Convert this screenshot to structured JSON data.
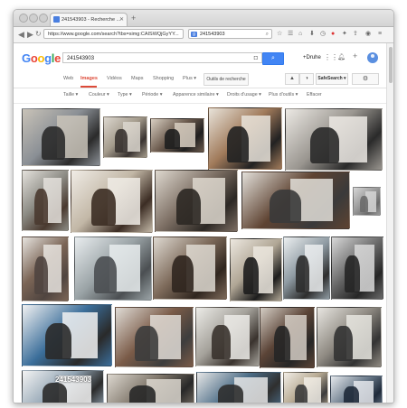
{
  "browser": {
    "tab_title": "241543903 - Recherche ...",
    "url": "https://www.google.com/search?tbs=simg:CAISWQjGyYY...",
    "search_box_value": "241543903"
  },
  "google": {
    "logo": "Google",
    "query": "241543903",
    "user": "+Druhe",
    "nav_tabs": [
      "Web",
      "Images",
      "Vidéos",
      "Maps",
      "Shopping",
      "Plus ▾"
    ],
    "search_by_size": "Outils de recherche",
    "safesearch": "SafeSearch ▾",
    "tools": [
      "Taille ▾",
      "Couleur ▾",
      "Type ▾",
      "Période ▾",
      "Apparence similaire ▾",
      "Droits d'usage ▾",
      "Plus d'outils ▾",
      "Effacer"
    ]
  },
  "results": {
    "watermark": "241543903",
    "images": [
      {
        "colors": [
          "#8a8f95",
          "#2b2b2b",
          "#c9c3b8"
        ]
      },
      {
        "colors": [
          "#a39a8b",
          "#3a3431",
          "#dcd7cf"
        ]
      },
      {
        "colors": [
          "#6b5a4d",
          "#1f1f1f",
          "#d8cfc2"
        ]
      },
      {
        "colors": [
          "#a07a5a",
          "#222222",
          "#e8e3da"
        ]
      },
      {
        "colors": [
          "#9a9690",
          "#2a2a2a",
          "#ece9e4"
        ]
      },
      {
        "colors": [
          "#8c8b84",
          "#4a3a30",
          "#e4e1dc"
        ]
      },
      {
        "colors": [
          "#c2b7a6",
          "#3c2d24",
          "#f0ece6"
        ]
      },
      {
        "colors": [
          "#7c6e63",
          "#2c2824",
          "#ded8cf"
        ]
      },
      {
        "colors": [
          "#5e4332",
          "#3a3a3a",
          "#e2dfd9"
        ]
      },
      {
        "colors": [
          "#9b9b9b",
          "#6b6b6b",
          "#d6d6d6"
        ]
      },
      {
        "colors": [
          "#7b6556",
          "#504540",
          "#e7e4df"
        ]
      },
      {
        "colors": [
          "#9aa3a6",
          "#4b4f52",
          "#e9edef"
        ]
      },
      {
        "colors": [
          "#7d6a5a",
          "#30261f",
          "#ded9d1"
        ]
      },
      {
        "colors": [
          "#b0a695",
          "#1d1d1d",
          "#ece7df"
        ]
      },
      {
        "colors": [
          "#8e9aa2",
          "#2e2e2e",
          "#eceff0"
        ]
      },
      {
        "colors": [
          "#6a6a6a",
          "#262626",
          "#d9d9d9"
        ]
      },
      {
        "colors": [
          "#3b6e9a",
          "#2a2a2a",
          "#f2f2f2"
        ]
      },
      {
        "colors": [
          "#7a5b48",
          "#3d3d3d",
          "#e0dcd6"
        ]
      },
      {
        "colors": [
          "#a4a19a",
          "#3a332e",
          "#ecebe7"
        ]
      },
      {
        "colors": [
          "#5b4437",
          "#262626",
          "#d4cdc4"
        ]
      },
      {
        "colors": [
          "#8f8a82",
          "#333333",
          "#e8e6e1"
        ]
      },
      {
        "colors": [
          "#93a5b4",
          "#2b2b2b",
          "#f3f3f3"
        ]
      },
      {
        "colors": [
          "#7d7468",
          "#282828",
          "#dcd7cf"
        ]
      },
      {
        "colors": [
          "#4b6c86",
          "#2f2f2f",
          "#e6e6e6"
        ]
      },
      {
        "colors": [
          "#b7aa93",
          "#3c3c3c",
          "#f1ede6"
        ]
      },
      {
        "colors": [
          "#6c7c8c",
          "#1f2a3a",
          "#e5e8ec"
        ]
      },
      {
        "colors": [
          "#9a7f68",
          "#3a3a3a",
          "#ede7de"
        ]
      },
      {
        "colors": [
          "#8c9a8c",
          "#2c2c2c",
          "#f0f0ee"
        ]
      }
    ]
  }
}
